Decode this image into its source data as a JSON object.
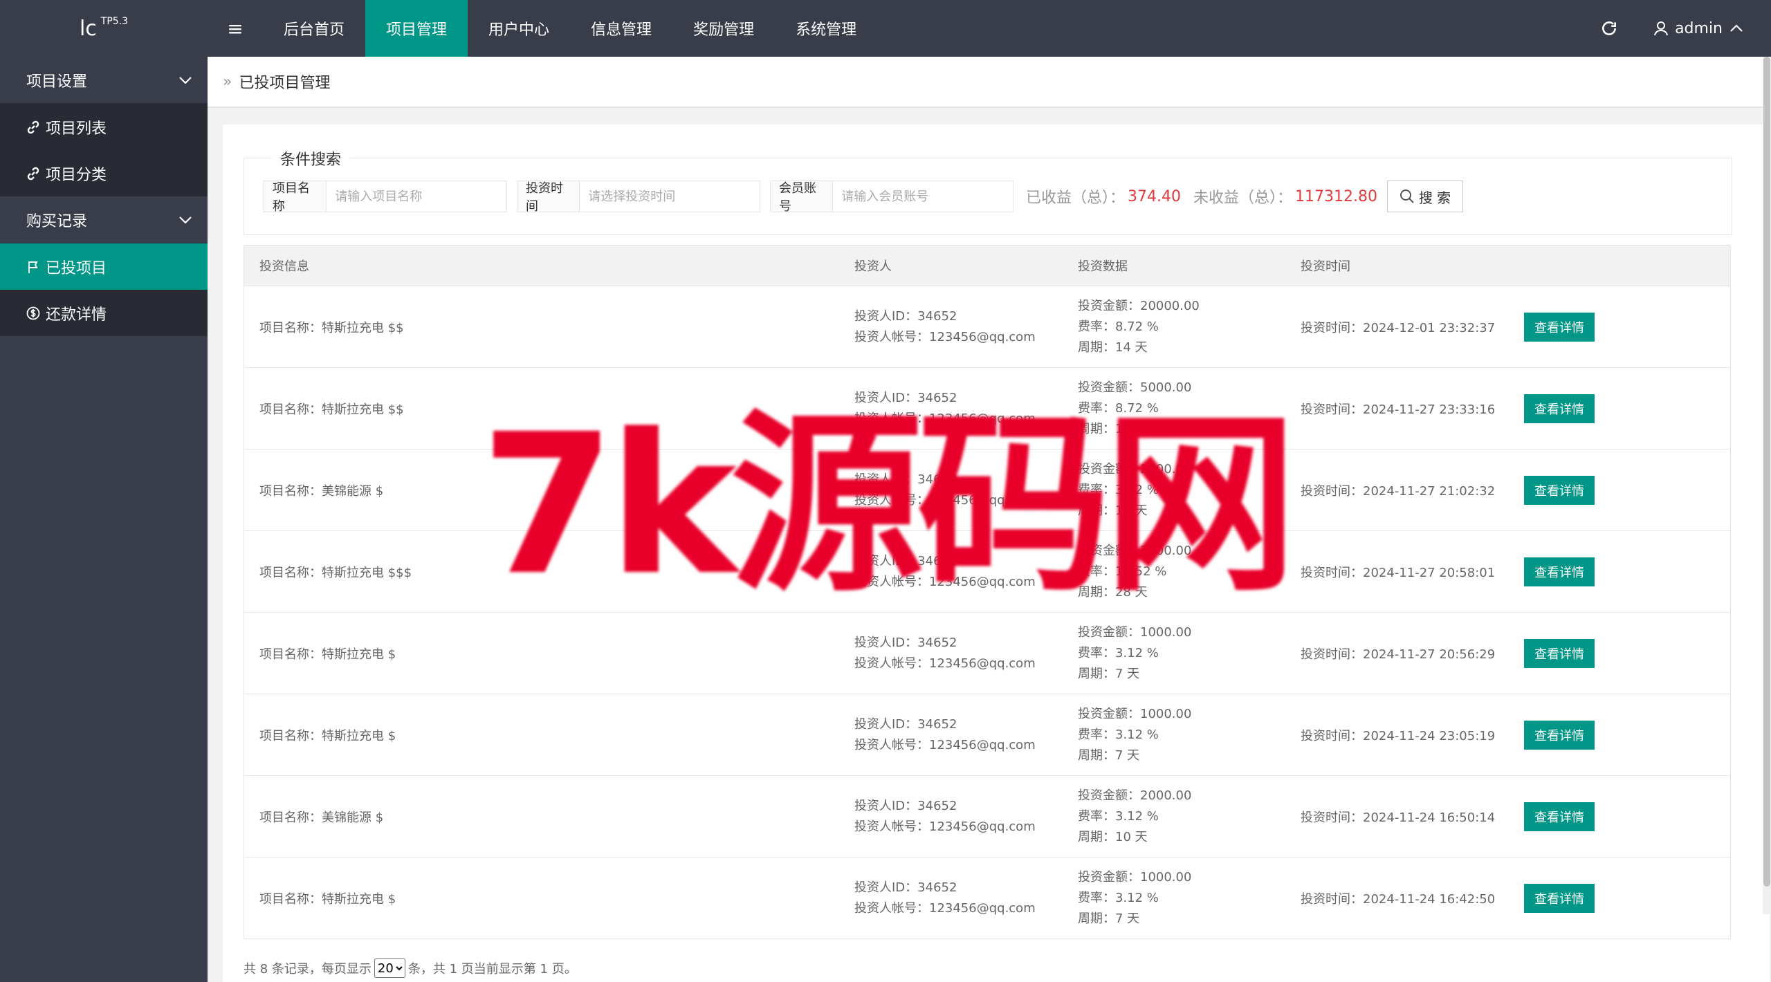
{
  "logo": {
    "main": "lc",
    "sup": "TP5.3"
  },
  "header": {
    "menu_icon": "≡",
    "nav": [
      {
        "label": "后台首页",
        "active": false
      },
      {
        "label": "项目管理",
        "active": true
      },
      {
        "label": "用户中心",
        "active": false
      },
      {
        "label": "信息管理",
        "active": false
      },
      {
        "label": "奖励管理",
        "active": false
      },
      {
        "label": "系统管理",
        "active": false
      }
    ],
    "user": "admin"
  },
  "sidebar": {
    "group1": "项目设置",
    "item_list": "项目列表",
    "item_cat": "项目分类",
    "group2": "购买记录",
    "item_invested": "已投项目",
    "item_repay": "还款详情"
  },
  "breadcrumb": {
    "current": "已投项目管理"
  },
  "search": {
    "legend": "条件搜索",
    "name_label": "项目名称",
    "name_placeholder": "请输入项目名称",
    "time_label": "投资时间",
    "time_placeholder": "请选择投资时间",
    "account_label": "会员账号",
    "account_placeholder": "请输入会员账号",
    "earned_label": "已收益（总）：",
    "earned_value": "374.40",
    "unearned_label": "未收益（总）：",
    "unearned_value": "117312.80",
    "button": "搜 索"
  },
  "table": {
    "headers": [
      "投资信息",
      "投资人",
      "投资数据",
      "投资时间"
    ],
    "rows": [
      {
        "name": "项目名称：特斯拉充电 $$",
        "investor_id": "投资人ID：34652",
        "investor_account": "投资人帐号：123456@qq.com",
        "amount": "投资金额：20000.00",
        "rate": "费率：8.72 %",
        "period": "周期：14 天",
        "time": "投资时间：2024-12-01 23:32:37",
        "btn": "查看详情"
      },
      {
        "name": "项目名称：特斯拉充电 $$",
        "investor_id": "投资人ID：34652",
        "investor_account": "投资人帐号：123456@qq.com",
        "amount": "投资金额：5000.00",
        "rate": "费率：8.72 %",
        "period": "周期：14 天",
        "time": "投资时间：2024-11-27 23:33:16",
        "btn": "查看详情"
      },
      {
        "name": "项目名称：美锦能源 $",
        "investor_id": "投资人ID：34652",
        "investor_account": "投资人帐号：123456@qq.com",
        "amount": "投资金额：2000.00",
        "rate": "费率：3.12 %",
        "period": "周期：10 天",
        "time": "投资时间：2024-11-27 21:02:32",
        "btn": "查看详情"
      },
      {
        "name": "项目名称：特斯拉充电 $$$",
        "investor_id": "投资人ID：34652",
        "investor_account": "投资人帐号：123456@qq.com",
        "amount": "投资金额：2000.00",
        "rate": "费率：15.52 %",
        "period": "周期：28 天",
        "time": "投资时间：2024-11-27 20:58:01",
        "btn": "查看详情"
      },
      {
        "name": "项目名称：特斯拉充电 $",
        "investor_id": "投资人ID：34652",
        "investor_account": "投资人帐号：123456@qq.com",
        "amount": "投资金额：1000.00",
        "rate": "费率：3.12 %",
        "period": "周期：7 天",
        "time": "投资时间：2024-11-27 20:56:29",
        "btn": "查看详情"
      },
      {
        "name": "项目名称：特斯拉充电 $",
        "investor_id": "投资人ID：34652",
        "investor_account": "投资人帐号：123456@qq.com",
        "amount": "投资金额：1000.00",
        "rate": "费率：3.12 %",
        "period": "周期：7 天",
        "time": "投资时间：2024-11-24 23:05:19",
        "btn": "查看详情"
      },
      {
        "name": "项目名称：美锦能源 $",
        "investor_id": "投资人ID：34652",
        "investor_account": "投资人帐号：123456@qq.com",
        "amount": "投资金额：2000.00",
        "rate": "费率：3.12 %",
        "period": "周期：10 天",
        "time": "投资时间：2024-11-24 16:50:14",
        "btn": "查看详情"
      },
      {
        "name": "项目名称：特斯拉充电 $",
        "investor_id": "投资人ID：34652",
        "investor_account": "投资人帐号：123456@qq.com",
        "amount": "投资金额：1000.00",
        "rate": "费率：3.12 %",
        "period": "周期：7 天",
        "time": "投资时间：2024-11-24 16:42:50",
        "btn": "查看详情"
      }
    ]
  },
  "pager": {
    "prefix": "共 8 条记录，每页显示",
    "per_page": "20",
    "suffix": "条，共 1 页当前显示第 1 页。"
  },
  "watermark": "7k源码网",
  "colors": {
    "accent": "#009688",
    "dark": "#393d49",
    "highlight": "#e4393c"
  }
}
